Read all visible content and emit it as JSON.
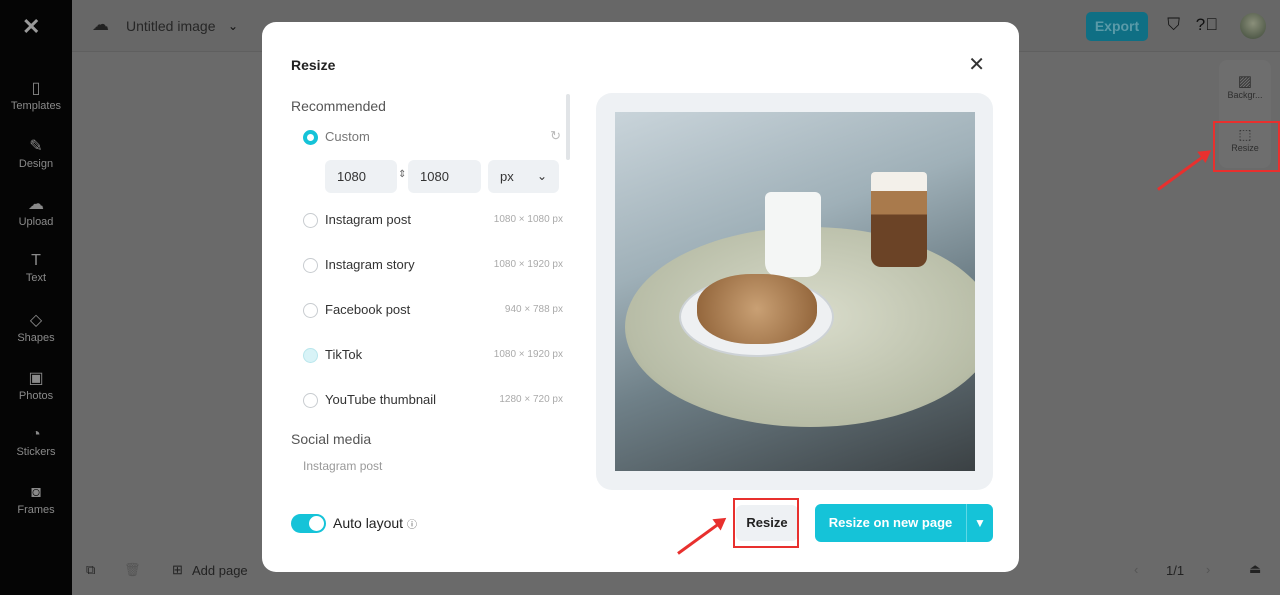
{
  "sidebar": {
    "items": [
      {
        "label": "Templates",
        "icon": "templates-icon"
      },
      {
        "label": "Design",
        "icon": "design-icon"
      },
      {
        "label": "Upload",
        "icon": "upload-icon"
      },
      {
        "label": "Text",
        "icon": "text-icon"
      },
      {
        "label": "Shapes",
        "icon": "shapes-icon"
      },
      {
        "label": "Photos",
        "icon": "photos-icon"
      },
      {
        "label": "Stickers",
        "icon": "stickers-icon"
      },
      {
        "label": "Frames",
        "icon": "frames-icon"
      }
    ]
  },
  "topbar": {
    "title": "Untitled image",
    "export": "Export"
  },
  "right_panel": {
    "background": "Backgr...",
    "resize": "Resize"
  },
  "bottombar": {
    "add_page": "Add page",
    "page": "1/1"
  },
  "modal": {
    "title": "Resize",
    "recommended": "Recommended",
    "custom": {
      "label": "Custom",
      "width": "1080",
      "height": "1080",
      "unit": "px"
    },
    "options": [
      {
        "label": "Instagram post",
        "size": "1080 × 1080 px"
      },
      {
        "label": "Instagram story",
        "size": "1080 × 1920 px"
      },
      {
        "label": "Facebook post",
        "size": "940 × 788 px"
      },
      {
        "label": "TikTok",
        "size": "1080 × 1920 px"
      },
      {
        "label": "YouTube thumbnail",
        "size": "1280 × 720 px"
      }
    ],
    "social_media": "Social media",
    "social_first": "Instagram post",
    "auto_layout": "Auto layout",
    "auto_layout_on": true,
    "resize_button": "Resize",
    "resize_new_button": "Resize on new page"
  },
  "colors": {
    "accent": "#15c3d8",
    "highlight": "#e8302e"
  }
}
